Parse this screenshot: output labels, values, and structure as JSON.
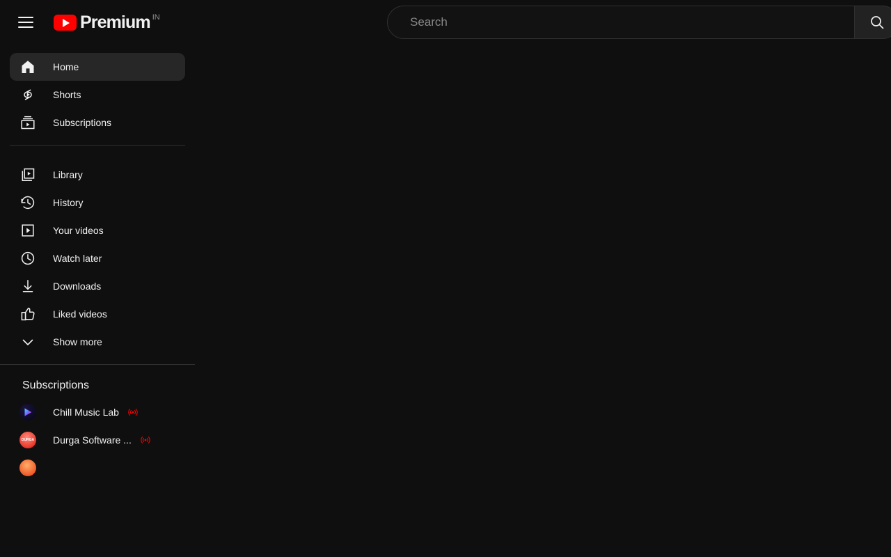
{
  "header": {
    "menu_icon": "hamburger-menu-icon",
    "logo": {
      "play_icon": "youtube-play-icon",
      "wordmark": "Premium",
      "country_code": "IN"
    }
  },
  "search": {
    "placeholder": "Search",
    "value": "",
    "button_icon": "search-icon"
  },
  "sidebar": {
    "primary": [
      {
        "label": "Home",
        "icon": "home-icon",
        "active": true
      },
      {
        "label": "Shorts",
        "icon": "shorts-icon",
        "active": false
      },
      {
        "label": "Subscriptions",
        "icon": "subscriptions-icon",
        "active": false
      }
    ],
    "secondary": [
      {
        "label": "Library",
        "icon": "library-icon"
      },
      {
        "label": "History",
        "icon": "history-icon"
      },
      {
        "label": "Your videos",
        "icon": "your-videos-icon"
      },
      {
        "label": "Watch later",
        "icon": "watch-later-icon"
      },
      {
        "label": "Downloads",
        "icon": "downloads-icon"
      },
      {
        "label": "Liked videos",
        "icon": "liked-videos-icon"
      },
      {
        "label": "Show more",
        "icon": "chevron-down-icon"
      }
    ],
    "subscriptions": {
      "title": "Subscriptions",
      "channels": [
        {
          "name": "Chill Music Lab",
          "avatar": "chill-music-lab-avatar",
          "live": true,
          "live_icon": "live-broadcast-icon",
          "avatar_text": ""
        },
        {
          "name": "Durga Software ...",
          "avatar": "durga-software-avatar",
          "live": true,
          "live_icon": "live-broadcast-icon",
          "avatar_text": "DURGA"
        },
        {
          "name": "",
          "avatar": "third-channel-avatar",
          "live": false,
          "live_icon": "",
          "avatar_text": ""
        }
      ]
    }
  },
  "colors": {
    "background": "#0f0f0f",
    "surface": "#272727",
    "brand_red": "#ff0000",
    "live_red": "#ff0000",
    "text_primary": "#f1f1f1",
    "text_secondary": "#888888",
    "border": "#303030"
  }
}
